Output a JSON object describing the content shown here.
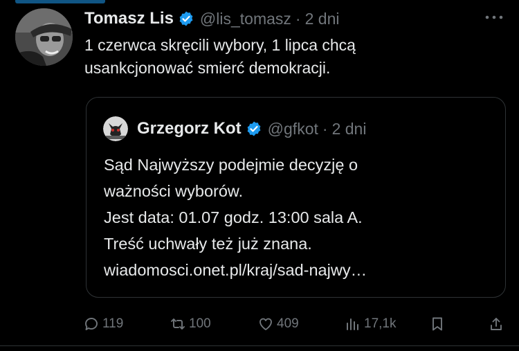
{
  "tweet": {
    "author_name": "Tomasz Lis",
    "handle": "@lis_tomasz",
    "separator": "·",
    "time": "2 dni",
    "text": "1 czerwca skręcili wybory, 1 lipca chcą\nusankcjonować smierć demokracji."
  },
  "quoted": {
    "author_name": "Grzegorz Kot",
    "handle": "@gfkot",
    "separator": "·",
    "time": "2 dni",
    "text": "Sąd Najwyższy podejmie decyzję o\nważności wyborów.\nJest data: 01.07 godz. 13:00 sala A.\nTreść uchwały też już znana.\nwiadomosci.onet.pl/kraj/sad-najwy…"
  },
  "actions": {
    "replies": "119",
    "retweets": "100",
    "likes": "409",
    "views": "17,1k"
  },
  "colors": {
    "background": "#000000",
    "text": "#e7e9ea",
    "muted": "#71767b",
    "verified": "#1d9bf0",
    "border": "#2f3336"
  },
  "icons": [
    "verified-badge-icon",
    "more-icon",
    "reply-icon",
    "retweet-icon",
    "like-icon",
    "views-icon",
    "bookmark-icon",
    "share-icon"
  ]
}
